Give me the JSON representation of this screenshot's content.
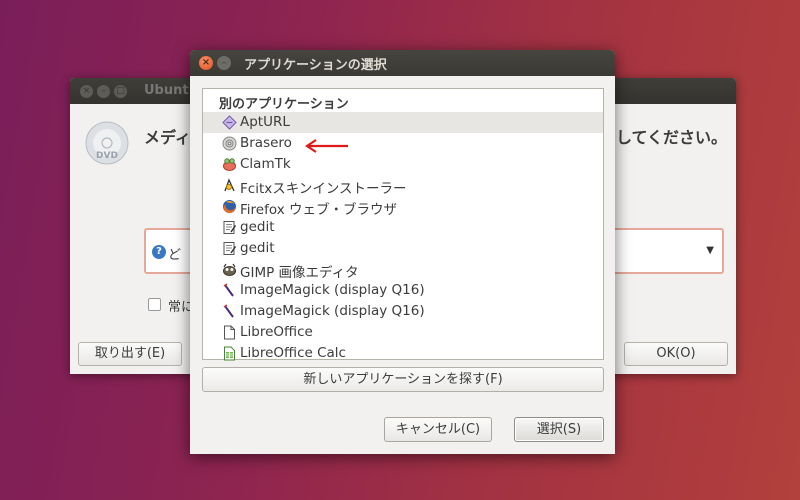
{
  "background_dialog": {
    "title": "Ubunt",
    "heading_left": "メディ",
    "heading_right": "してください。",
    "combo_text": "ど",
    "checkbox_label": "常に",
    "eject_button": "取り出す(E)",
    "ok_button": "OK(O)"
  },
  "dialog": {
    "title": "アプリケーションの選択",
    "list_header": "別のアプリケーション",
    "items": [
      {
        "label": "AptURL",
        "icon": "apturl-icon"
      },
      {
        "label": "Brasero",
        "icon": "disc-icon"
      },
      {
        "label": "ClamTk",
        "icon": "clamtk-icon"
      },
      {
        "label": "Fcitxスキンインストーラー",
        "icon": "fcitx-icon"
      },
      {
        "label": "Firefox ウェブ・ブラウザ",
        "icon": "firefox-icon"
      },
      {
        "label": "gedit",
        "icon": "text-editor-icon"
      },
      {
        "label": "gedit",
        "icon": "text-editor-icon"
      },
      {
        "label": "GIMP 画像エディタ",
        "icon": "gimp-icon"
      },
      {
        "label": "ImageMagick (display Q16)",
        "icon": "imagemagick-icon"
      },
      {
        "label": "ImageMagick (display Q16)",
        "icon": "imagemagick-icon"
      },
      {
        "label": "LibreOffice",
        "icon": "libreoffice-icon"
      },
      {
        "label": "LibreOffice Calc",
        "icon": "libreoffice-calc-icon"
      }
    ],
    "new_app_button": "新しいアプリケーションを探す(F)",
    "cancel_button": "キャンセル(C)",
    "select_button": "選択(S)"
  },
  "colors": {
    "annotation_arrow": "#e0191b",
    "close_button": "#e95420"
  }
}
